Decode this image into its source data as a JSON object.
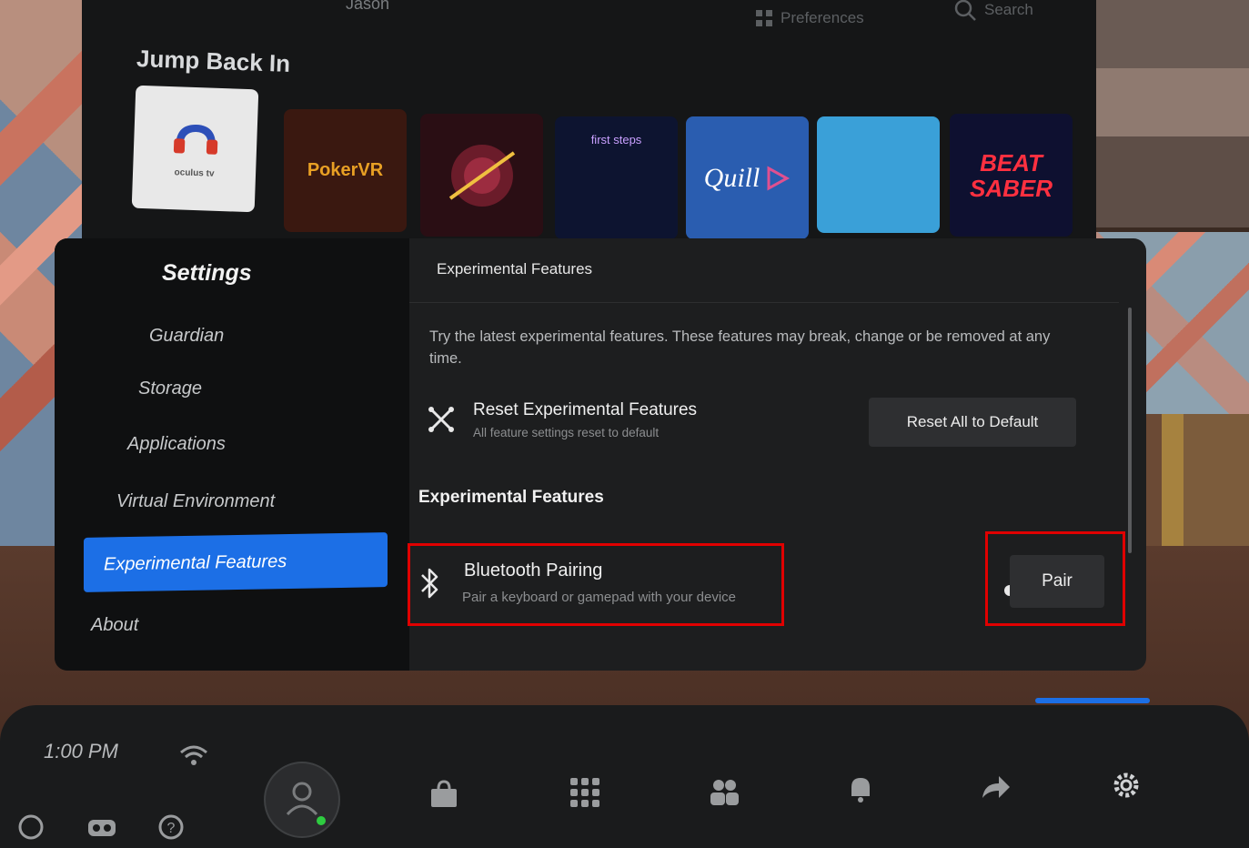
{
  "store": {
    "user_name": "Jason",
    "preferences_label": "Preferences",
    "search_label": "Search",
    "jump_back_title": "Jump Back In",
    "tiles": [
      {
        "label": "oculus tv",
        "bg": "#e8e8e8",
        "fg": "#2d4fb8"
      },
      {
        "label": "PokerVR",
        "bg": "#3a1810",
        "fg": "#e8a024"
      },
      {
        "label": "",
        "bg": "#2a0e14",
        "fg": "#ffffff"
      },
      {
        "label": "first steps",
        "bg": "#0d1430",
        "fg": "#c9a0ff"
      },
      {
        "label": "Quill",
        "bg": "#2a5db0",
        "fg": "#ffffff"
      },
      {
        "label": "",
        "bg": "#3aa0d8",
        "fg": "#ffffff"
      },
      {
        "label": "BEAT SABER",
        "bg": "#0e1030",
        "fg": "#ff3040"
      }
    ]
  },
  "settings": {
    "title": "Settings",
    "sidebar": [
      {
        "label": "Guardian"
      },
      {
        "label": "Storage"
      },
      {
        "label": "Applications"
      },
      {
        "label": "Virtual Environment"
      },
      {
        "label": "Experimental Features",
        "active": true
      },
      {
        "label": "About"
      }
    ],
    "header_title": "Experimental Features",
    "description": "Try the latest experimental features. These features may break, change or be removed at any time.",
    "reset": {
      "title": "Reset Experimental Features",
      "subtitle": "All feature settings reset to default",
      "button_label": "Reset All to Default",
      "icon": "close-x-icon"
    },
    "section_title": "Experimental Features",
    "bluetooth": {
      "title": "Bluetooth Pairing",
      "subtitle": "Pair a keyboard or gamepad with your device",
      "button_label": "Pair",
      "icon": "bluetooth-icon"
    }
  },
  "dock": {
    "time": "1:00 PM",
    "icons": [
      "wifi-icon",
      "store-icon",
      "apps-grid-icon",
      "people-icon",
      "notifications-icon",
      "share-icon",
      "settings-icon"
    ]
  },
  "colors": {
    "accent": "#1c6fe6",
    "highlight": "#e00000",
    "panel": "#1d1e1f",
    "sidebar": "#0f1011"
  }
}
